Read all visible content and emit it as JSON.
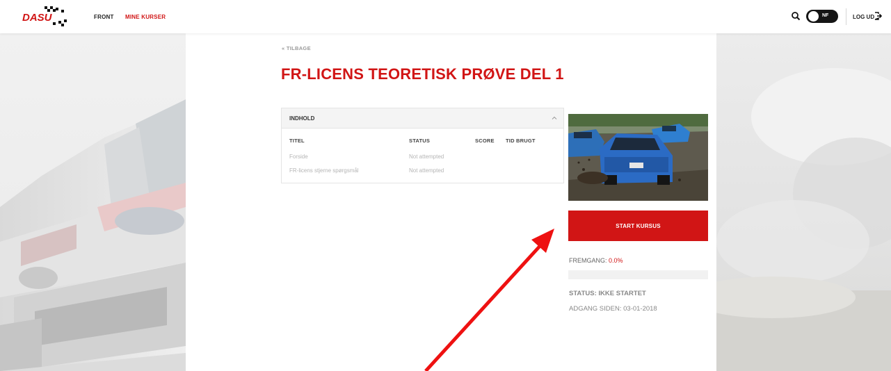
{
  "header": {
    "logo_alt": "DASU",
    "nav": [
      {
        "label": "FRONT",
        "active": false
      },
      {
        "label": "MINE KURSER",
        "active": true
      }
    ],
    "toggle_label": "NF",
    "logout_label": "LOG UD",
    "icons": [
      "search-icon",
      "logout-icon"
    ]
  },
  "page": {
    "back_label": "« TILBAGE",
    "title": "FR-LICENS TEORETISK PRØVE DEL 1"
  },
  "contents_panel": {
    "title": "INDHOLD",
    "columns": [
      "TITEL",
      "STATUS",
      "SCORE",
      "TID BRUGT"
    ],
    "rows": [
      {
        "title": "Forside",
        "status": "Not attempted",
        "score": "",
        "time": ""
      },
      {
        "title": "FR-licens stjerne spørgsmål",
        "status": "Not attempted",
        "score": "",
        "time": ""
      }
    ]
  },
  "course": {
    "start_label": "START KURSUS",
    "progress_label": "FREMGANG:",
    "progress_value": "0.0%",
    "progress_fraction": 0.0,
    "status": "STATUS: IKKE STARTET",
    "access": "ADGANG SIDEN: 03-01-2018"
  },
  "colors": {
    "accent": "#d11515",
    "annotation_arrow": "#ee1111"
  }
}
